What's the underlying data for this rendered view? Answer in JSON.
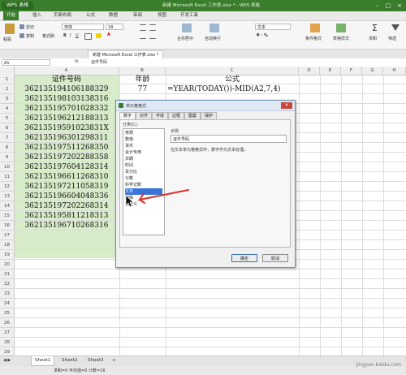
{
  "titlebar": {
    "app_tab": "WPS 表格",
    "title": "新建 Microsoft Excel 工作表.xlsx * - WPS 表格"
  },
  "menu": {
    "tabs": [
      "开始",
      "插入",
      "页面布局",
      "公式",
      "数据",
      "审阅",
      "视图",
      "开发工具"
    ]
  },
  "ribbon": {
    "paste": "粘贴",
    "cut": "剪切",
    "copy": "复制",
    "format_painter": "格式刷",
    "font_name": "宋体",
    "font_size": "18",
    "merge_center": "合并居中",
    "auto_wrap": "自动换行",
    "number_format": "文本",
    "conditional_format": "条件格式",
    "table_style": "表格样式",
    "sum": "求和",
    "filter": "筛选"
  },
  "doc_tab": "新建 Microsoft Excel 工作表.xlsx *",
  "formula_bar": {
    "name_box": "A1",
    "fx": "fx",
    "content": "证件号码"
  },
  "columns": [
    "A",
    "B",
    "C",
    "D",
    "E",
    "F",
    "G",
    "H"
  ],
  "rows": [
    "1",
    "2",
    "3",
    "4",
    "5",
    "6",
    "7",
    "8",
    "9",
    "10",
    "11",
    "12",
    "13",
    "14",
    "15",
    "16",
    "17",
    "18",
    "19",
    "20",
    "21",
    "22",
    "23",
    "24",
    "25",
    "26",
    "27",
    "28",
    "29"
  ],
  "sheet": {
    "header_a": "证件号码",
    "header_b": "年龄",
    "header_c": "公式",
    "b2": "77",
    "c2": "=YEAR(TODAY())-MID(A2,7,4)",
    "ids": [
      "362135194106188329",
      "362135198103138316",
      "362135195701028332",
      "362135196212188313",
      "36213519591023831X",
      "362135196301298311",
      "362135197511268350",
      "362135197202288358",
      "362135197604128314",
      "362135196611268310",
      "362135197211058319",
      "362135196604048336",
      "362135197202268314",
      "362135195811218313",
      "362135196710268316"
    ]
  },
  "dialog": {
    "title": "单元格格式",
    "tabs": [
      "数字",
      "对齐",
      "字体",
      "边框",
      "图案",
      "保护"
    ],
    "category_label": "分类(C):",
    "categories": [
      "常规",
      "数值",
      "货币",
      "会计专用",
      "日期",
      "时间",
      "百分比",
      "分数",
      "科学记数",
      "文本",
      "特殊",
      "自定义"
    ],
    "selected_category": "文本",
    "sample_label": "示例",
    "sample_value": "证件号码",
    "description": "在文本单元格格式中，数字作为文本处理。",
    "ok": "确定",
    "cancel": "取消"
  },
  "sheets": [
    "Sheet1",
    "Sheet2",
    "Sheet3"
  ],
  "status": "求和=0  平均值=0  计数=16",
  "watermark": "jingyan.baidu.com",
  "colors": {
    "accent": "#3a7d2c",
    "column_highlight": "#d7ecc9",
    "selection": "#3875d7",
    "arrow": "#d9302c"
  }
}
